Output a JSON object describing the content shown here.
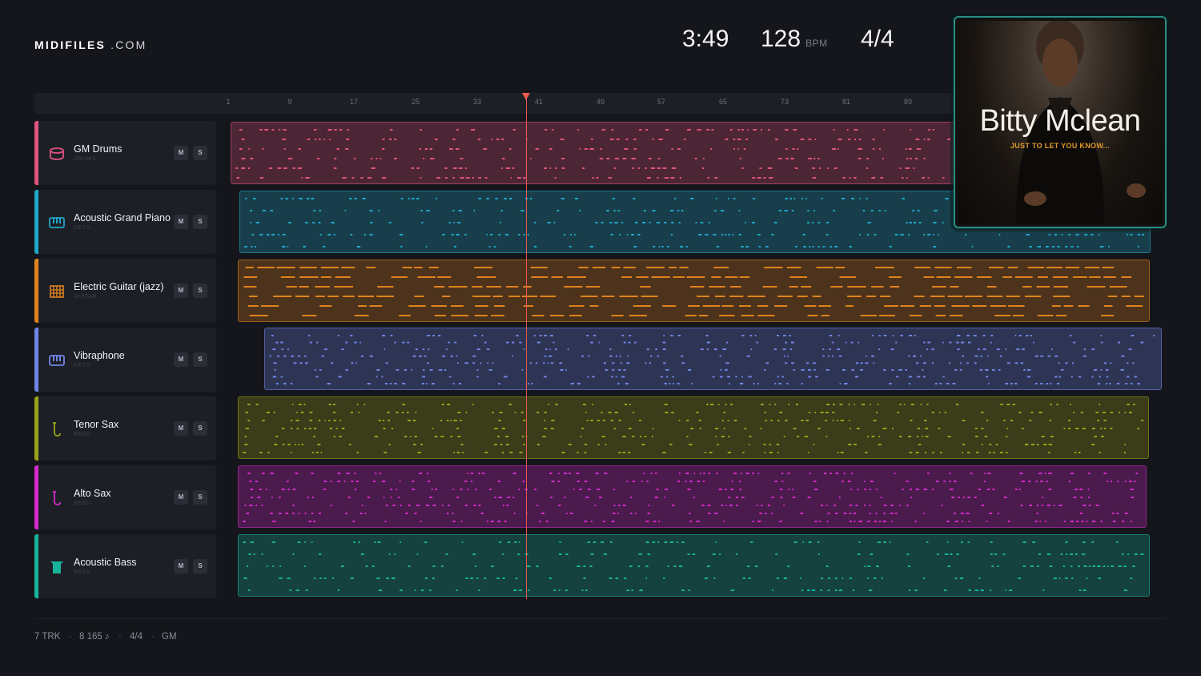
{
  "header": {
    "logo_bold": "MIDIFILES",
    "logo_light": ".COM",
    "time": "3:49",
    "tempo": "128",
    "tempo_unit": "BPM",
    "meter": "4/4"
  },
  "ruler": {
    "ticks": [
      "1",
      "9",
      "17",
      "25",
      "33",
      "41",
      "49",
      "57",
      "65",
      "73",
      "81",
      "89"
    ]
  },
  "playhead": {
    "bar": 39.7
  },
  "tracks": [
    {
      "name": "GM Drums",
      "category": "DRUMS",
      "color": "#e0537f",
      "icon": "drum-icon",
      "mute": "M",
      "solo": "S"
    },
    {
      "name": "Acoustic Grand Piano",
      "category": "KEYS",
      "color": "#1fa8c9",
      "icon": "piano-icon",
      "mute": "M",
      "solo": "S"
    },
    {
      "name": "Electric Guitar (jazz)",
      "category": "GUITAR",
      "color": "#e0821c",
      "icon": "guitar-icon",
      "mute": "M",
      "solo": "S"
    },
    {
      "name": "Vibraphone",
      "category": "KEYS",
      "color": "#6f86e6",
      "icon": "vibraphone-icon",
      "mute": "M",
      "solo": "S"
    },
    {
      "name": "Tenor Sax",
      "category": "REED",
      "color": "#9aa318",
      "icon": "sax-icon",
      "mute": "M",
      "solo": "S"
    },
    {
      "name": "Alto Sax",
      "category": "REED",
      "color": "#d42bcb",
      "icon": "sax-icon",
      "mute": "M",
      "solo": "S"
    },
    {
      "name": "Acoustic Bass",
      "category": "BASS",
      "color": "#17b39a",
      "icon": "bass-icon",
      "mute": "M",
      "solo": "S"
    }
  ],
  "footer": {
    "tracks": "7 TRK",
    "notes": "8 165 ♪",
    "meter": "4/4",
    "standard": "GM",
    "separator": "·"
  },
  "cover": {
    "artist": "Bitty Mclean",
    "album": "JUST TO LET YOU KNOW..."
  }
}
